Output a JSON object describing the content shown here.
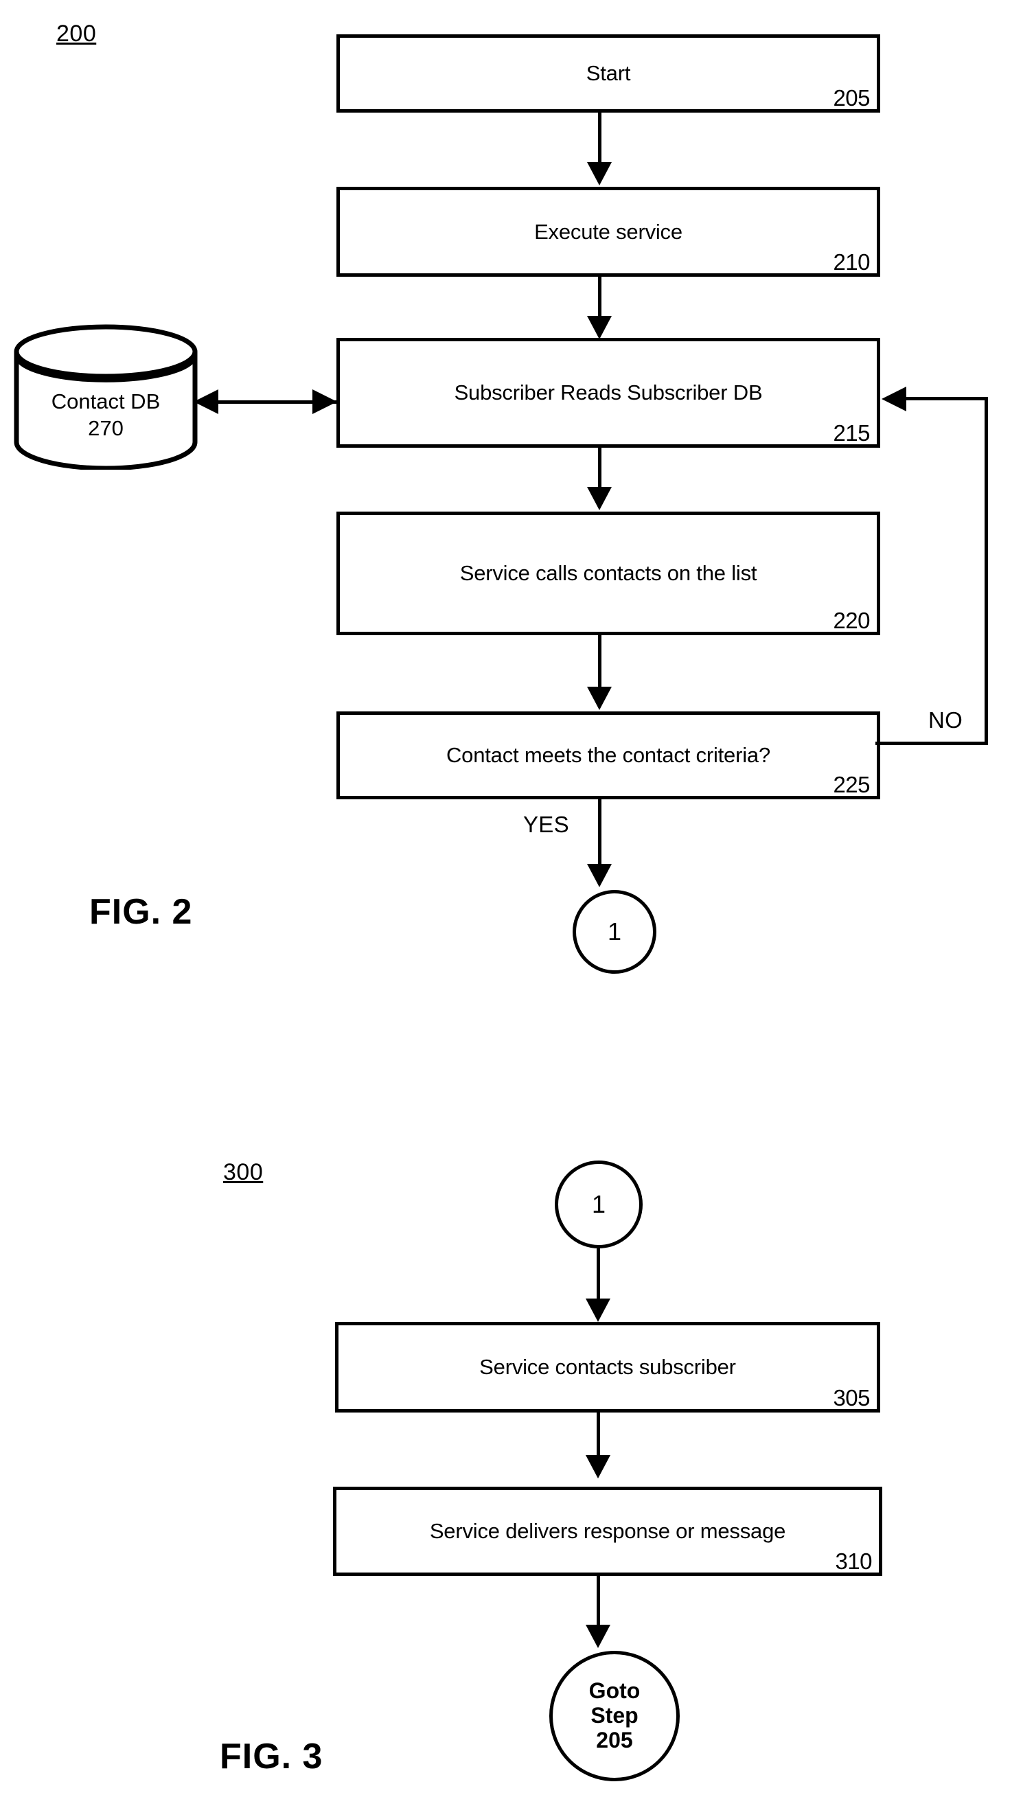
{
  "figures": [
    {
      "id": "fig2",
      "figure_label": "FIG. 2",
      "diagram_ref": "200",
      "nodes": {
        "start": {
          "text": "Start",
          "ref": "205"
        },
        "execute": {
          "text": "Execute service",
          "ref": "210"
        },
        "read_db": {
          "text": "Subscriber Reads Subscriber DB",
          "ref": "215"
        },
        "call_contacts": {
          "text": "Service calls contacts on the list",
          "ref": "220"
        },
        "decision": {
          "text": "Contact meets the contact criteria?",
          "ref": "225"
        },
        "database": {
          "text": "Contact DB",
          "ref": "270"
        },
        "connector_out": {
          "text": "1"
        }
      },
      "edge_labels": {
        "no": "NO",
        "yes": "YES"
      }
    },
    {
      "id": "fig3",
      "figure_label": "FIG. 3",
      "diagram_ref": "300",
      "nodes": {
        "connector_in": {
          "text": "1"
        },
        "contacts_subscriber": {
          "text": "Service contacts subscriber",
          "ref": "305"
        },
        "delivers": {
          "text": "Service delivers response or message",
          "ref": "310"
        },
        "goto": {
          "line1": "Goto",
          "line2": "Step",
          "line3": "205"
        }
      }
    }
  ],
  "colors": {
    "ink": "#000000",
    "paper": "#ffffff"
  }
}
